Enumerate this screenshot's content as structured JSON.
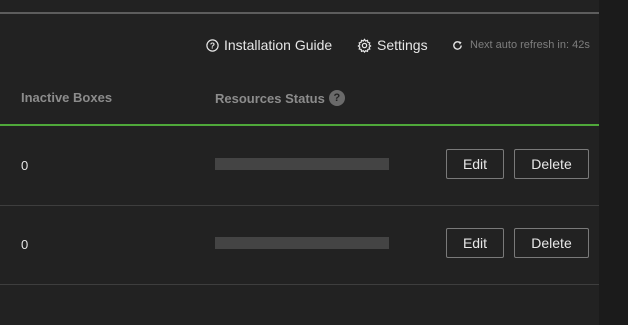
{
  "toolbar": {
    "installation_guide_label": "Installation Guide",
    "installation_guide_icon": "help-circle-icon",
    "settings_label": "Settings",
    "settings_icon": "gear-icon",
    "refresh_text": "Next auto refresh in: 42s",
    "refresh_icon": "refresh-icon"
  },
  "table": {
    "columns": [
      {
        "label": "Inactive Boxes"
      },
      {
        "label": "Resources Status",
        "help_icon": "help-icon",
        "help_glyph": "?"
      }
    ],
    "rows": [
      {
        "inactive_boxes": "0",
        "resources_status_fraction": 1.0,
        "edit_label": "Edit",
        "delete_label": "Delete"
      },
      {
        "inactive_boxes": "0",
        "resources_status_fraction": 1.0,
        "edit_label": "Edit",
        "delete_label": "Delete"
      }
    ]
  },
  "colors": {
    "background": "#222222",
    "header_accent": "#4fa83a",
    "status_bar": "#444444",
    "muted_text": "#8c8c8c"
  }
}
